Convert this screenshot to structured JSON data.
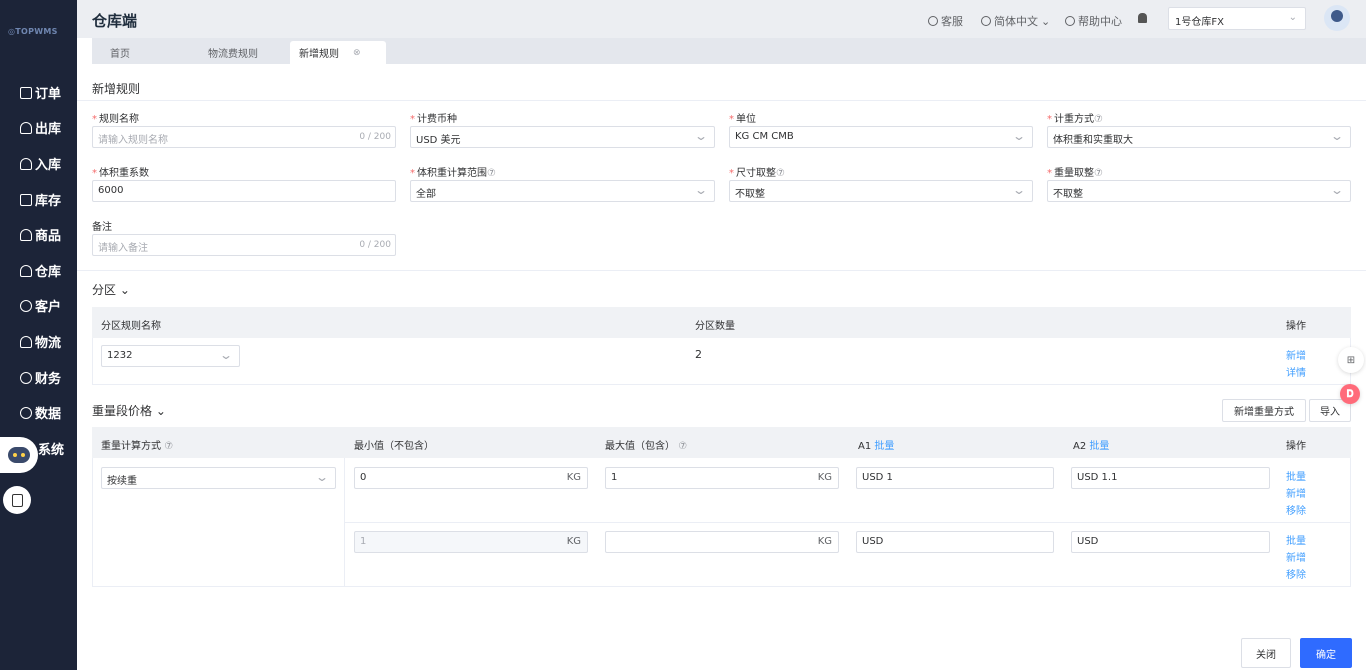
{
  "app": {
    "logo": "TOPWMS",
    "title": "仓库端"
  },
  "sidebar": {
    "items": [
      {
        "label": "订单",
        "icon": "list-icon"
      },
      {
        "label": "出库",
        "icon": "box-out-icon"
      },
      {
        "label": "入库",
        "icon": "box-in-icon"
      },
      {
        "label": "库存",
        "icon": "inventory-icon"
      },
      {
        "label": "商品",
        "icon": "shopping-bag-icon"
      },
      {
        "label": "仓库",
        "icon": "warehouse-icon"
      },
      {
        "label": "客户",
        "icon": "user-icon"
      },
      {
        "label": "物流",
        "icon": "logistics-icon"
      },
      {
        "label": "财务",
        "icon": "finance-icon"
      },
      {
        "label": "数据",
        "icon": "data-icon"
      },
      {
        "label": "系统",
        "icon": "system-icon"
      }
    ]
  },
  "topbar": {
    "service": "客服",
    "language": "简体中文",
    "help": "帮助中心",
    "warehouse": "1号仓库FX"
  },
  "tabs": [
    {
      "label": "首页"
    },
    {
      "label": "物流费规则"
    },
    {
      "label": "新增规则"
    }
  ],
  "page": {
    "title": "新增规则"
  },
  "form": {
    "rule_name": {
      "label": "规则名称",
      "placeholder": "请输入规则名称",
      "count": "0 / 200"
    },
    "currency": {
      "label": "计费币种",
      "value": "USD 美元"
    },
    "unit": {
      "label": "单位",
      "value": "KG CM CMB"
    },
    "calc_method": {
      "label": "计重方式",
      "value": "体积重和实重取大"
    },
    "vol_factor": {
      "label": "体积重系数",
      "value": "6000"
    },
    "vol_range": {
      "label": "体积重计算范围",
      "value": "全部"
    },
    "size_round": {
      "label": "尺寸取整",
      "value": "不取整"
    },
    "weight_round": {
      "label": "重量取整",
      "value": "不取整"
    },
    "remark": {
      "label": "备注",
      "placeholder": "请输入备注",
      "count": "0 / 200"
    }
  },
  "zone": {
    "title": "分区",
    "headers": [
      "分区规则名称",
      "分区数量",
      "操作"
    ],
    "row": {
      "name": "1232",
      "count": "2",
      "actions": [
        "新增",
        "详情"
      ]
    }
  },
  "weight": {
    "title": "重量段价格",
    "add_btn": "新增重量方式",
    "import_btn": "导入",
    "headers": {
      "method": "重量计算方式",
      "min": "最小值（不包含）",
      "max": "最大值（包含）",
      "a1": "A1",
      "a2": "A2",
      "batch": "批量",
      "ops": "操作"
    },
    "method_value": "按续重",
    "rows": [
      {
        "min": "0",
        "max": "1",
        "a1": "USD  1",
        "a2": "USD  1.1",
        "unit": "KG",
        "actions": [
          "批量",
          "新增",
          "移除"
        ]
      },
      {
        "min": "1",
        "max": "",
        "a1": "USD",
        "a2": "USD",
        "unit": "KG",
        "actions": [
          "批量",
          "新增",
          "移除"
        ]
      }
    ]
  },
  "footer": {
    "close": "关闭",
    "confirm": "确定"
  },
  "float": {
    "badge": "𝐃"
  }
}
